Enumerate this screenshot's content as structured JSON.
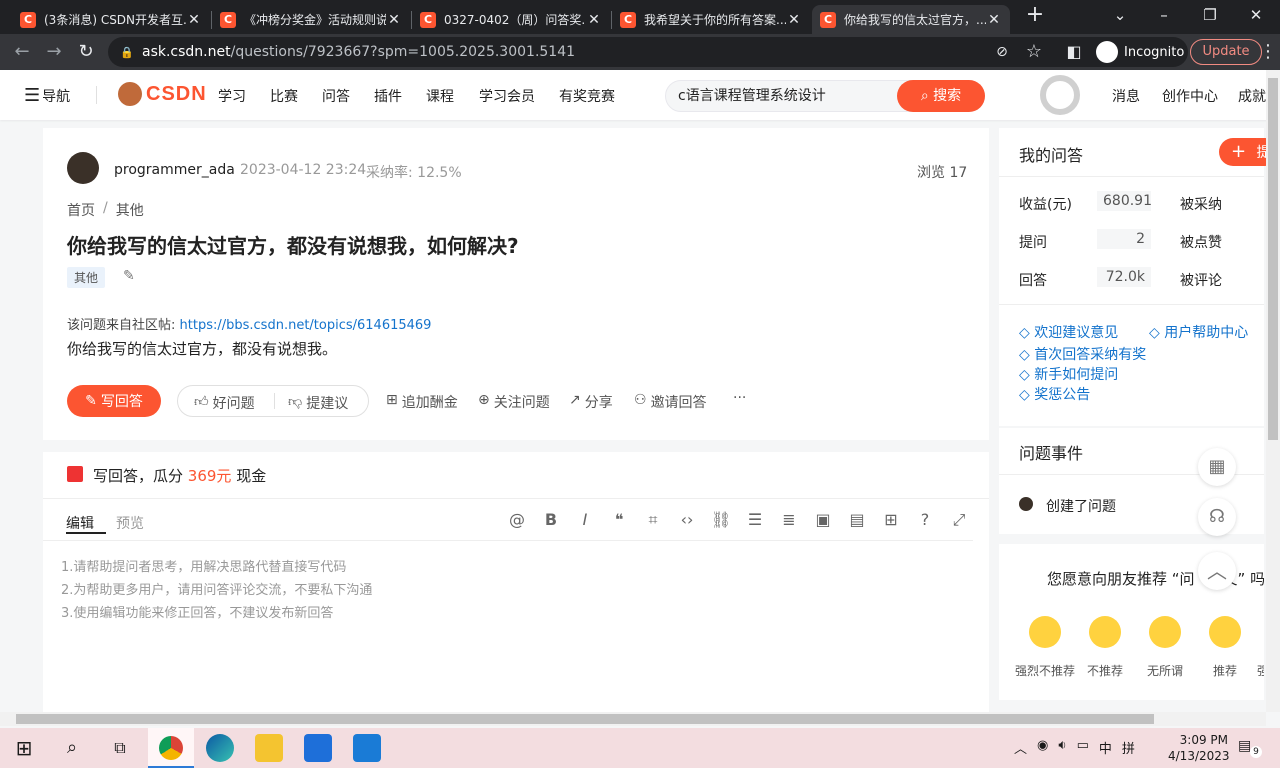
{
  "browser": {
    "tabs": [
      {
        "title": "(3条消息) CSDN开发者互..."
      },
      {
        "title": "《冲榜分奖金》活动规则说..."
      },
      {
        "title": "0327-0402（周）问答奖..."
      },
      {
        "title": "我希望关于你的所有答案..."
      },
      {
        "title": "你给我写的信太过官方，..."
      }
    ],
    "url_host": "ask.csdn.net",
    "url_path": "/questions/7923667?spm=1005.2025.3001.5141",
    "incognito_label": "Incognito",
    "update_label": "Update"
  },
  "header": {
    "nav_label": "导航",
    "logo": "CSDN",
    "nav_items": [
      "学习",
      "比赛",
      "问答",
      "插件",
      "课程",
      "学习会员",
      "有奖竞赛"
    ],
    "search_value": "c语言课程管理系统设计",
    "search_button": "搜索",
    "right_items": [
      "消息",
      "创作中心",
      "成就"
    ]
  },
  "question": {
    "author": "programmer_ada",
    "date": "2023-04-12 23:24",
    "adopt_rate": "采纳率: 12.5%",
    "views": "浏览 17",
    "breadcrumb": [
      "首页",
      "/",
      "其他"
    ],
    "title": "你给我写的信太过官方，都没有说想我，如何解决?",
    "tag": "其他",
    "source_prefix": "该问题来自社区帖:",
    "source_link": "https://bbs.csdn.net/topics/614615469",
    "body": "你给我写的信太过官方，都没有说想我。",
    "actions": {
      "write": "写回答",
      "good": "好问题",
      "suggest": "提建议",
      "bounty": "追加酬金",
      "follow": "关注问题",
      "share": "分享",
      "invite": "邀请回答",
      "more": "···"
    }
  },
  "answer_box": {
    "prefix": "写回答，瓜分",
    "amount": "369元",
    "suffix": "现金",
    "tab_edit": "编辑",
    "tab_preview": "预览",
    "hints": [
      "1.请帮助提问者思考，用解决思路代替直接写代码",
      "2.为帮助更多用户，请用问答评论交流，不要私下沟通",
      "3.使用编辑功能来修正回答，不建议发布新回答"
    ]
  },
  "sidebar": {
    "my_qa_title": "我的问答",
    "ask_button": "提",
    "stats": [
      {
        "label": "收益(元)",
        "value": "680.91",
        "right": "被采纳"
      },
      {
        "label": "提问",
        "value": "2",
        "right": "被点赞"
      },
      {
        "label": "回答",
        "value": "72.0k",
        "right": "被评论"
      }
    ],
    "links": [
      "欢迎建议意见",
      "用户帮助中心",
      "首次回答采纳有奖",
      "新手如何提问",
      "奖惩公告"
    ],
    "events_title": "问题事件",
    "event_text": "创建了问题",
    "recommend_title": "您愿意向朋友推荐 “问",
    "recommend_title_end": "又” 吗",
    "ratings": [
      "强烈不推荐",
      "不推荐",
      "无所谓",
      "推荐",
      "强"
    ]
  },
  "taskbar": {
    "time": "3:09 PM",
    "date": "4/13/2023",
    "ime": "中",
    "notif_count": "9"
  },
  "colors": {
    "brand": "#fc5531",
    "link": "#1473cc"
  }
}
